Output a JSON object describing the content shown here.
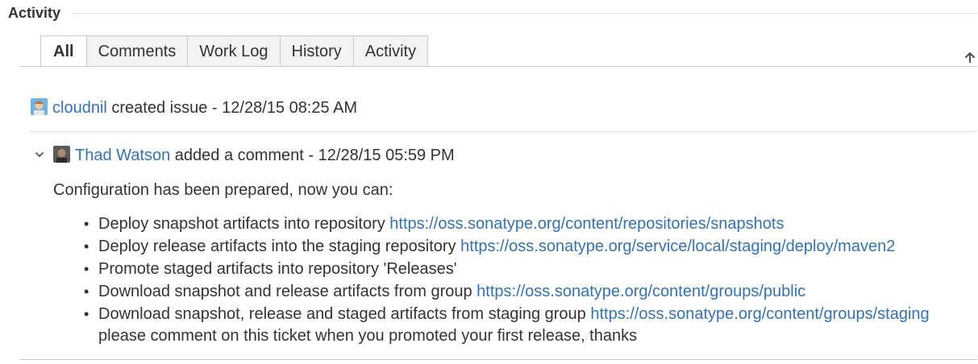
{
  "module": {
    "title": "Activity"
  },
  "tabs": [
    {
      "label": "All",
      "active": true
    },
    {
      "label": "Comments",
      "active": false
    },
    {
      "label": "Work Log",
      "active": false
    },
    {
      "label": "History",
      "active": false
    },
    {
      "label": "Activity",
      "active": false
    }
  ],
  "sort_icon": "arrow-up-icon",
  "created": {
    "user": "cloudnil",
    "action": "created issue",
    "separator": "-",
    "timestamp": "12/28/15 08:25 AM",
    "avatar_icon": "user-avatar-icon"
  },
  "comment": {
    "user": "Thad Watson",
    "action": "added a comment",
    "separator": "-",
    "timestamp": "12/28/15 05:59 PM",
    "avatar_icon": "user-avatar-icon",
    "collapse_icon": "chevron-down-icon",
    "intro": "Configuration has been prepared, now you can:",
    "items": [
      {
        "text": "Deploy snapshot artifacts into repository",
        "link": "https://oss.sonatype.org/content/repositories/snapshots"
      },
      {
        "text": "Deploy release artifacts into the staging repository",
        "link": "https://oss.sonatype.org/service/local/staging/deploy/maven2"
      },
      {
        "text": "Promote staged artifacts into repository 'Releases'",
        "link": ""
      },
      {
        "text": "Download snapshot and release artifacts from group",
        "link": "https://oss.sonatype.org/content/groups/public"
      },
      {
        "text": "Download snapshot, release and staged artifacts from staging group",
        "link": "https://oss.sonatype.org/content/groups/staging"
      }
    ],
    "after": "please comment on this ticket when you promoted your first release, thanks"
  },
  "colors": {
    "link": "#3572b0",
    "text": "#333333",
    "tab_bg": "#f3f3f3",
    "border": "#cccccc"
  }
}
